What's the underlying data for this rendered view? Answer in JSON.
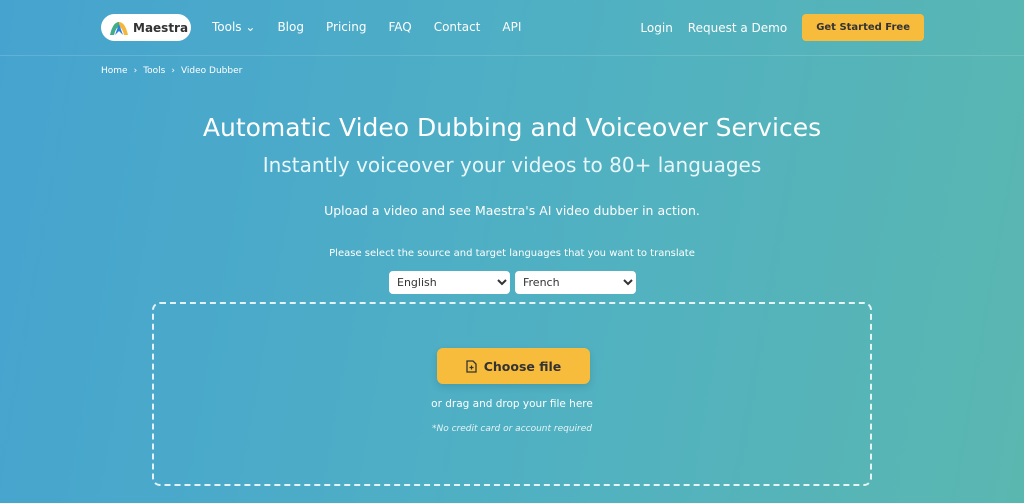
{
  "nav": {
    "logo": "Maestra",
    "links": [
      "Tools",
      "Blog",
      "Pricing",
      "FAQ",
      "Contact",
      "API"
    ],
    "login": "Login",
    "demo": "Request a Demo",
    "cta": "Get Started Free"
  },
  "breadcrumb": [
    "Home",
    "Tools",
    "Video Dubber"
  ],
  "hero": {
    "title": "Automatic Video Dubbing and Voiceover Services",
    "subtitle": "Instantly voiceover your videos to 80+ languages",
    "description": "Upload a video and see Maestra's AI video dubber in action.",
    "instruction": "Please select the source and target languages that you want to translate"
  },
  "languages": {
    "source": "English",
    "target": "French"
  },
  "upload": {
    "button": "Choose file",
    "drag": "or drag and drop your file here",
    "note": "*No credit card or account required"
  },
  "colors": {
    "accent": "#f8bc3c"
  }
}
